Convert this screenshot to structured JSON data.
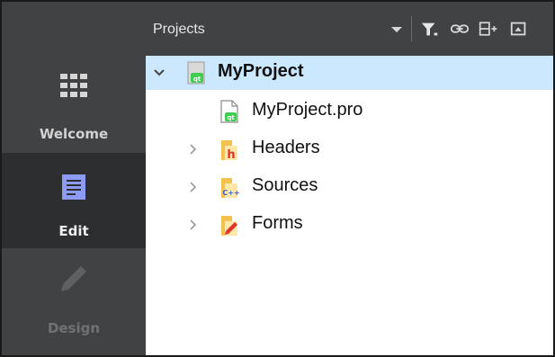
{
  "sidebar": {
    "modes": [
      {
        "label": "Welcome",
        "icon": "grid-icon"
      },
      {
        "label": "Edit",
        "icon": "document-icon",
        "active": true
      },
      {
        "label": "Design",
        "icon": "pencil-icon",
        "disabled": true
      }
    ]
  },
  "projects_panel": {
    "title": "Projects",
    "toolbar_icons": [
      "dropdown-arrow-icon",
      "filter-icon",
      "link-icon",
      "split-add-icon",
      "close-pane-icon"
    ]
  },
  "tree": {
    "root": {
      "label": "MyProject",
      "expanded": true,
      "icon": "qt-project-icon"
    },
    "children": [
      {
        "label": "MyProject.pro",
        "icon": "qt-pro-file-icon",
        "expandable": false
      },
      {
        "label": "Headers",
        "icon": "headers-folder-icon",
        "expandable": true
      },
      {
        "label": "Sources",
        "icon": "sources-folder-icon",
        "expandable": true
      },
      {
        "label": "Forms",
        "icon": "forms-folder-icon",
        "expandable": true
      }
    ]
  },
  "colors": {
    "sidebar_bg": "#404244",
    "sidebar_active_bg": "#2c2e30",
    "selection_bg": "#cce8ff",
    "qt_green": "#41cd52",
    "folder_yellow": "#f2c14e"
  }
}
